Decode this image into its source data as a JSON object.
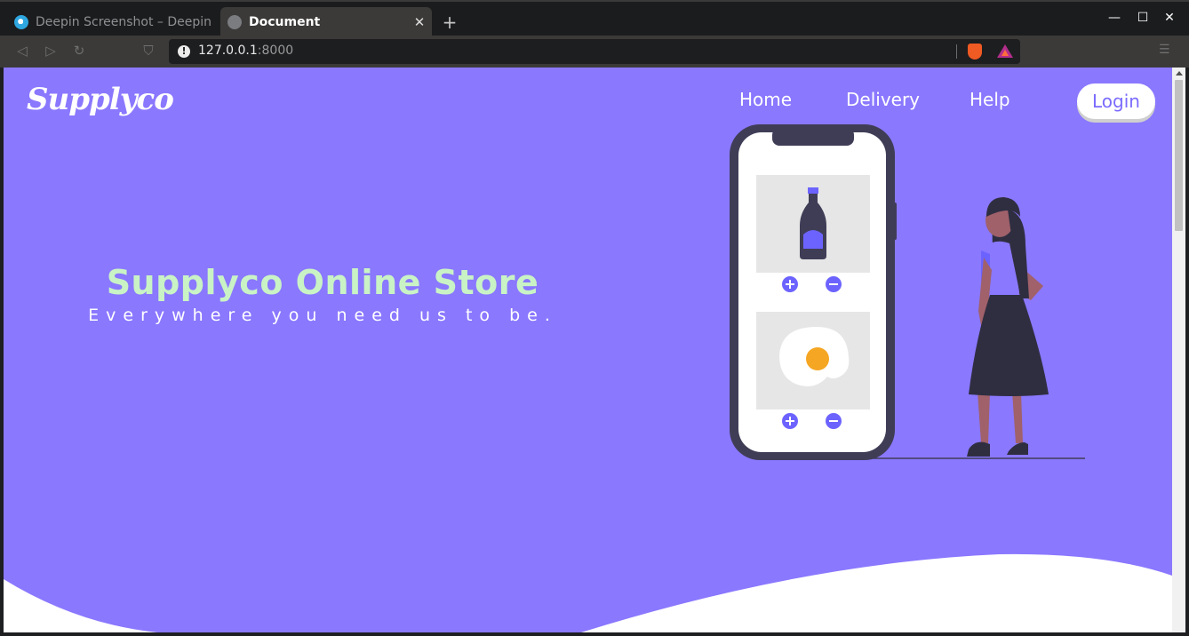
{
  "browser": {
    "tabs": [
      {
        "title": "Deepin Screenshot – Deepin T",
        "active": false
      },
      {
        "title": "Document",
        "active": true
      }
    ],
    "url_host": "127.0.0.1",
    "url_port": ":8000"
  },
  "page": {
    "logo": "Supplyco",
    "nav": {
      "home": "Home",
      "delivery": "Delivery",
      "help": "Help",
      "login": "Login"
    },
    "hero": {
      "title": "Supplyco Online Store",
      "subtitle": "Everywhere you need us to be."
    },
    "colors": {
      "background": "#8a78ff",
      "title": "#c9f3c5",
      "accent": "#6c63ff",
      "phone": "#3f3d56"
    }
  }
}
